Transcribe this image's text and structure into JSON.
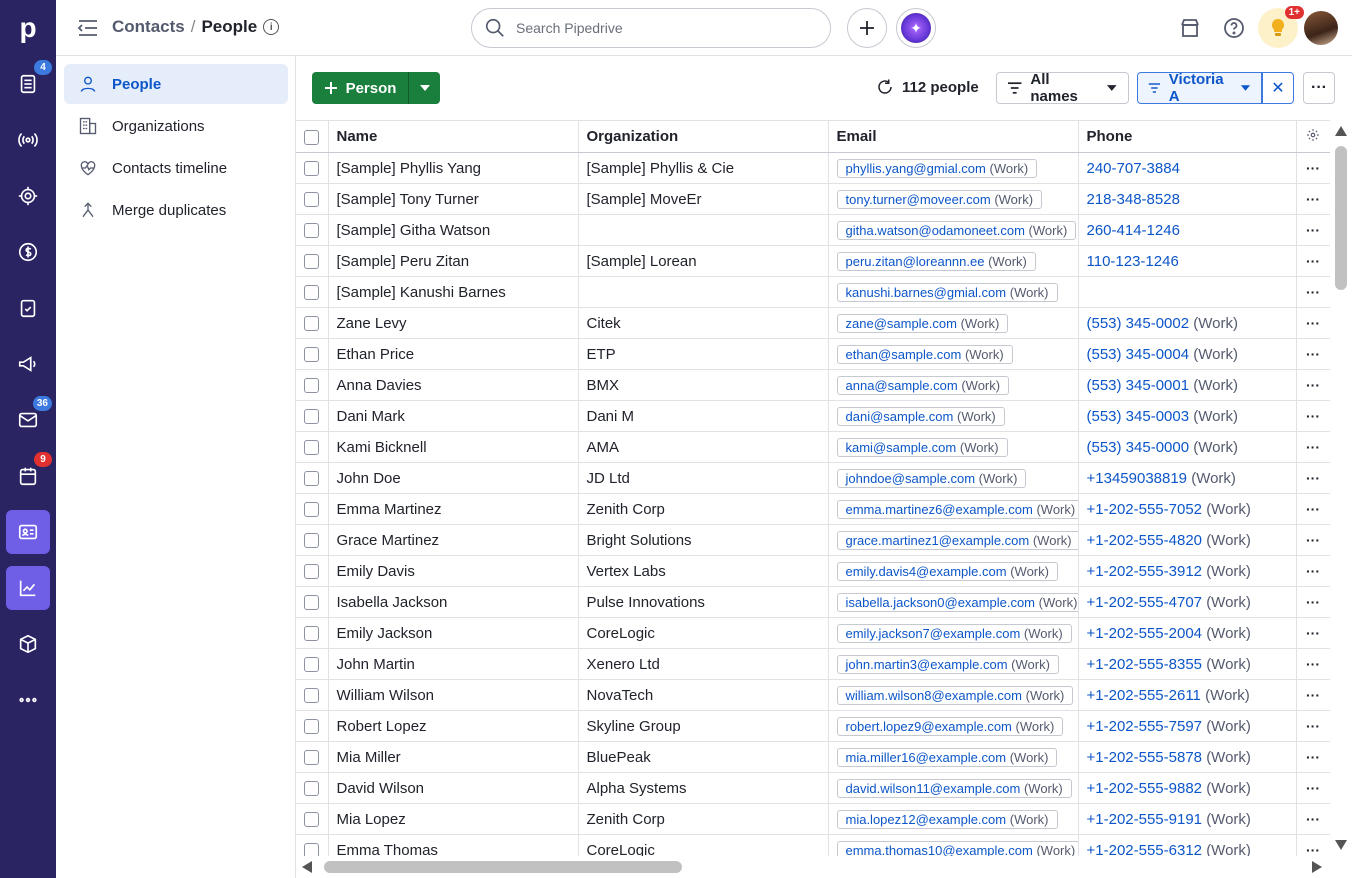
{
  "app": {
    "logo_letter": "p"
  },
  "rail": {
    "badges": {
      "deals": "4",
      "mail": "36",
      "calendar": "9"
    },
    "badge_colors": {
      "blue": "#3d7ae0",
      "red": "#e03030"
    }
  },
  "header": {
    "breadcrumb_parent": "Contacts",
    "breadcrumb_sep": "/",
    "breadcrumb_current": "People",
    "search_placeholder": "Search Pipedrive",
    "notification_badge": "1+"
  },
  "sidebar": {
    "items": [
      {
        "label": "People",
        "icon": "person-icon",
        "active": true
      },
      {
        "label": "Organizations",
        "icon": "building-icon"
      },
      {
        "label": "Contacts timeline",
        "icon": "heart-pulse-icon"
      },
      {
        "label": "Merge duplicates",
        "icon": "merge-icon"
      }
    ]
  },
  "toolbar": {
    "add_label": "Person",
    "count_label": "112 people",
    "names_filter": "All names",
    "owner_filter": "Victoria A"
  },
  "table": {
    "columns": [
      "Name",
      "Organization",
      "Email",
      "Phone"
    ],
    "rows": [
      {
        "name": "[Sample] Phyllis Yang",
        "org": "[Sample] Phyllis & Cie",
        "email": "phyllis.yang@gmial.com",
        "email_label": "(Work)",
        "phone": "240-707-3884",
        "phone_label": ""
      },
      {
        "name": "[Sample] Tony Turner",
        "org": "[Sample] MoveEr",
        "email": "tony.turner@moveer.com",
        "email_label": "(Work)",
        "phone": "218-348-8528",
        "phone_label": ""
      },
      {
        "name": "[Sample] Githa Watson",
        "org": "",
        "email": "githa.watson@odamoneet.com",
        "email_label": "(Work)",
        "phone": "260-414-1246",
        "phone_label": ""
      },
      {
        "name": "[Sample] Peru Zitan",
        "org": "[Sample] Lorean",
        "email": "peru.zitan@loreannn.ee",
        "email_label": "(Work)",
        "phone": "110-123-1246",
        "phone_label": ""
      },
      {
        "name": "[Sample] Kanushi Barnes",
        "org": "",
        "email": "kanushi.barnes@gmial.com",
        "email_label": "(Work)",
        "phone": "",
        "phone_label": ""
      },
      {
        "name": "Zane Levy",
        "org": "Citek",
        "email": "zane@sample.com",
        "email_label": "(Work)",
        "phone": "(553) 345-0002",
        "phone_label": "(Work)"
      },
      {
        "name": "Ethan Price",
        "org": "ETP",
        "email": "ethan@sample.com",
        "email_label": "(Work)",
        "phone": "(553) 345-0004",
        "phone_label": "(Work)"
      },
      {
        "name": "Anna Davies",
        "org": "BMX",
        "email": "anna@sample.com",
        "email_label": "(Work)",
        "phone": "(553) 345-0001",
        "phone_label": "(Work)"
      },
      {
        "name": "Dani Mark",
        "org": "Dani M",
        "email": "dani@sample.com",
        "email_label": "(Work)",
        "phone": "(553) 345-0003",
        "phone_label": "(Work)"
      },
      {
        "name": "Kami Bicknell",
        "org": "AMA",
        "email": "kami@sample.com",
        "email_label": "(Work)",
        "phone": "(553) 345-0000",
        "phone_label": "(Work)"
      },
      {
        "name": "John Doe",
        "org": "JD Ltd",
        "email": "johndoe@sample.com",
        "email_label": "(Work)",
        "phone": "+13459038819",
        "phone_label": "(Work)"
      },
      {
        "name": "Emma Martinez",
        "org": "Zenith Corp",
        "email": "emma.martinez6@example.com",
        "email_label": "(Work)",
        "phone": "+1-202-555-7052",
        "phone_label": "(Work)"
      },
      {
        "name": "Grace Martinez",
        "org": "Bright Solutions",
        "email": "grace.martinez1@example.com",
        "email_label": "(Work)",
        "phone": "+1-202-555-4820",
        "phone_label": "(Work)"
      },
      {
        "name": "Emily Davis",
        "org": "Vertex Labs",
        "email": "emily.davis4@example.com",
        "email_label": "(Work)",
        "phone": "+1-202-555-3912",
        "phone_label": "(Work)"
      },
      {
        "name": "Isabella Jackson",
        "org": "Pulse Innovations",
        "email": "isabella.jackson0@example.com",
        "email_label": "(Work)",
        "phone": "+1-202-555-4707",
        "phone_label": "(Work)"
      },
      {
        "name": "Emily Jackson",
        "org": "CoreLogic",
        "email": "emily.jackson7@example.com",
        "email_label": "(Work)",
        "phone": "+1-202-555-2004",
        "phone_label": "(Work)"
      },
      {
        "name": "John Martin",
        "org": "Xenero Ltd",
        "email": "john.martin3@example.com",
        "email_label": "(Work)",
        "phone": "+1-202-555-8355",
        "phone_label": "(Work)"
      },
      {
        "name": "William Wilson",
        "org": "NovaTech",
        "email": "william.wilson8@example.com",
        "email_label": "(Work)",
        "phone": "+1-202-555-2611",
        "phone_label": "(Work)"
      },
      {
        "name": "Robert Lopez",
        "org": "Skyline Group",
        "email": "robert.lopez9@example.com",
        "email_label": "(Work)",
        "phone": "+1-202-555-7597",
        "phone_label": "(Work)"
      },
      {
        "name": "Mia Miller",
        "org": "BluePeak",
        "email": "mia.miller16@example.com",
        "email_label": "(Work)",
        "phone": "+1-202-555-5878",
        "phone_label": "(Work)"
      },
      {
        "name": "David Wilson",
        "org": "Alpha Systems",
        "email": "david.wilson11@example.com",
        "email_label": "(Work)",
        "phone": "+1-202-555-9882",
        "phone_label": "(Work)"
      },
      {
        "name": "Mia Lopez",
        "org": "Zenith Corp",
        "email": "mia.lopez12@example.com",
        "email_label": "(Work)",
        "phone": "+1-202-555-9191",
        "phone_label": "(Work)"
      },
      {
        "name": "Emma Thomas",
        "org": "CoreLogic",
        "email": "emma.thomas10@example.com",
        "email_label": "(Work)",
        "phone": "+1-202-555-6312",
        "phone_label": "(Work)"
      }
    ]
  },
  "colors": {
    "rail_bg": "#2a2463",
    "rail_active": "#6f5ee6",
    "primary_green": "#1a7f3c",
    "link_blue": "#0c56c9"
  }
}
